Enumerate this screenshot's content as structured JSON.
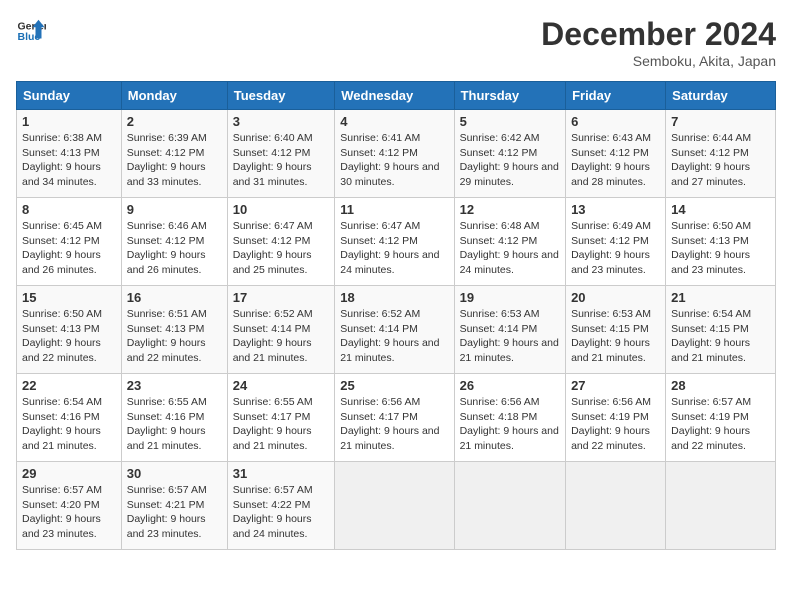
{
  "header": {
    "logo_line1": "General",
    "logo_line2": "Blue",
    "month": "December 2024",
    "location": "Semboku, Akita, Japan"
  },
  "weekdays": [
    "Sunday",
    "Monday",
    "Tuesday",
    "Wednesday",
    "Thursday",
    "Friday",
    "Saturday"
  ],
  "weeks": [
    [
      {
        "day": "1",
        "sunrise": "6:38 AM",
        "sunset": "4:13 PM",
        "daylight": "9 hours and 34 minutes."
      },
      {
        "day": "2",
        "sunrise": "6:39 AM",
        "sunset": "4:12 PM",
        "daylight": "9 hours and 33 minutes."
      },
      {
        "day": "3",
        "sunrise": "6:40 AM",
        "sunset": "4:12 PM",
        "daylight": "9 hours and 31 minutes."
      },
      {
        "day": "4",
        "sunrise": "6:41 AM",
        "sunset": "4:12 PM",
        "daylight": "9 hours and 30 minutes."
      },
      {
        "day": "5",
        "sunrise": "6:42 AM",
        "sunset": "4:12 PM",
        "daylight": "9 hours and 29 minutes."
      },
      {
        "day": "6",
        "sunrise": "6:43 AM",
        "sunset": "4:12 PM",
        "daylight": "9 hours and 28 minutes."
      },
      {
        "day": "7",
        "sunrise": "6:44 AM",
        "sunset": "4:12 PM",
        "daylight": "9 hours and 27 minutes."
      }
    ],
    [
      {
        "day": "8",
        "sunrise": "6:45 AM",
        "sunset": "4:12 PM",
        "daylight": "9 hours and 26 minutes."
      },
      {
        "day": "9",
        "sunrise": "6:46 AM",
        "sunset": "4:12 PM",
        "daylight": "9 hours and 26 minutes."
      },
      {
        "day": "10",
        "sunrise": "6:47 AM",
        "sunset": "4:12 PM",
        "daylight": "9 hours and 25 minutes."
      },
      {
        "day": "11",
        "sunrise": "6:47 AM",
        "sunset": "4:12 PM",
        "daylight": "9 hours and 24 minutes."
      },
      {
        "day": "12",
        "sunrise": "6:48 AM",
        "sunset": "4:12 PM",
        "daylight": "9 hours and 24 minutes."
      },
      {
        "day": "13",
        "sunrise": "6:49 AM",
        "sunset": "4:12 PM",
        "daylight": "9 hours and 23 minutes."
      },
      {
        "day": "14",
        "sunrise": "6:50 AM",
        "sunset": "4:13 PM",
        "daylight": "9 hours and 23 minutes."
      }
    ],
    [
      {
        "day": "15",
        "sunrise": "6:50 AM",
        "sunset": "4:13 PM",
        "daylight": "9 hours and 22 minutes."
      },
      {
        "day": "16",
        "sunrise": "6:51 AM",
        "sunset": "4:13 PM",
        "daylight": "9 hours and 22 minutes."
      },
      {
        "day": "17",
        "sunrise": "6:52 AM",
        "sunset": "4:14 PM",
        "daylight": "9 hours and 21 minutes."
      },
      {
        "day": "18",
        "sunrise": "6:52 AM",
        "sunset": "4:14 PM",
        "daylight": "9 hours and 21 minutes."
      },
      {
        "day": "19",
        "sunrise": "6:53 AM",
        "sunset": "4:14 PM",
        "daylight": "9 hours and 21 minutes."
      },
      {
        "day": "20",
        "sunrise": "6:53 AM",
        "sunset": "4:15 PM",
        "daylight": "9 hours and 21 minutes."
      },
      {
        "day": "21",
        "sunrise": "6:54 AM",
        "sunset": "4:15 PM",
        "daylight": "9 hours and 21 minutes."
      }
    ],
    [
      {
        "day": "22",
        "sunrise": "6:54 AM",
        "sunset": "4:16 PM",
        "daylight": "9 hours and 21 minutes."
      },
      {
        "day": "23",
        "sunrise": "6:55 AM",
        "sunset": "4:16 PM",
        "daylight": "9 hours and 21 minutes."
      },
      {
        "day": "24",
        "sunrise": "6:55 AM",
        "sunset": "4:17 PM",
        "daylight": "9 hours and 21 minutes."
      },
      {
        "day": "25",
        "sunrise": "6:56 AM",
        "sunset": "4:17 PM",
        "daylight": "9 hours and 21 minutes."
      },
      {
        "day": "26",
        "sunrise": "6:56 AM",
        "sunset": "4:18 PM",
        "daylight": "9 hours and 21 minutes."
      },
      {
        "day": "27",
        "sunrise": "6:56 AM",
        "sunset": "4:19 PM",
        "daylight": "9 hours and 22 minutes."
      },
      {
        "day": "28",
        "sunrise": "6:57 AM",
        "sunset": "4:19 PM",
        "daylight": "9 hours and 22 minutes."
      }
    ],
    [
      {
        "day": "29",
        "sunrise": "6:57 AM",
        "sunset": "4:20 PM",
        "daylight": "9 hours and 23 minutes."
      },
      {
        "day": "30",
        "sunrise": "6:57 AM",
        "sunset": "4:21 PM",
        "daylight": "9 hours and 23 minutes."
      },
      {
        "day": "31",
        "sunrise": "6:57 AM",
        "sunset": "4:22 PM",
        "daylight": "9 hours and 24 minutes."
      },
      null,
      null,
      null,
      null
    ]
  ],
  "labels": {
    "sunrise": "Sunrise:",
    "sunset": "Sunset:",
    "daylight": "Daylight:"
  }
}
